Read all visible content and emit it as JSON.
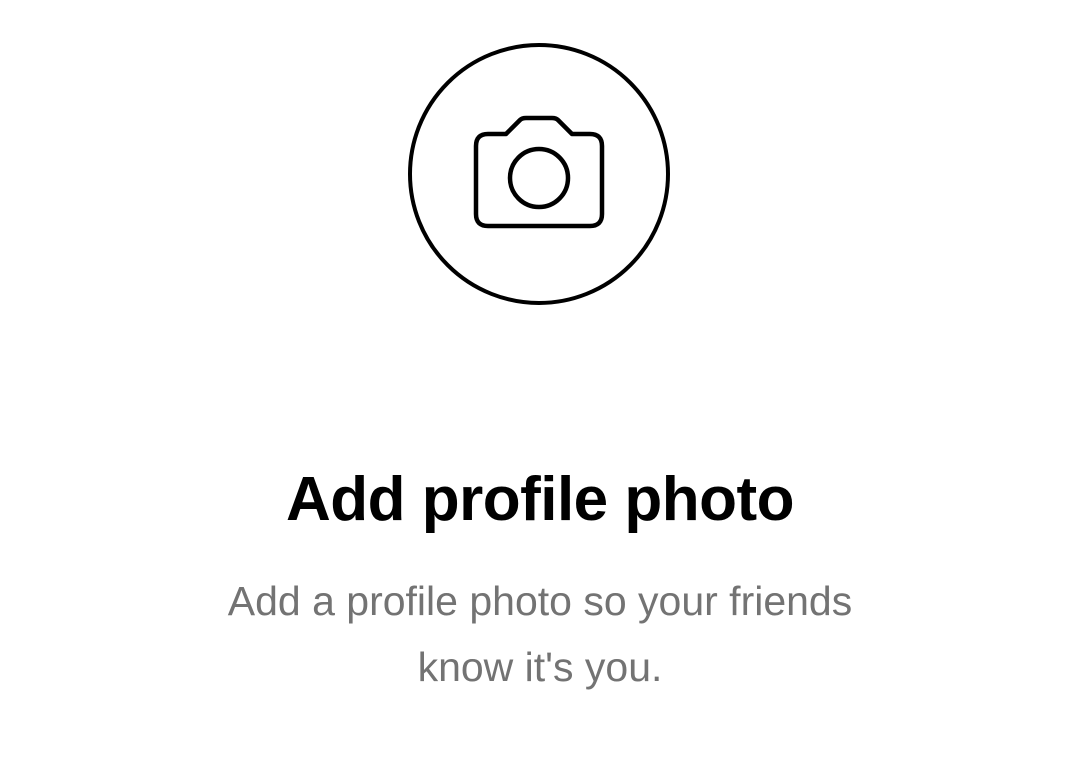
{
  "profile_photo": {
    "icon": "camera-icon",
    "title": "Add profile photo",
    "description_line1": "Add a profile photo so your friends",
    "description_line2": "know it's you."
  },
  "colors": {
    "background": "#ffffff",
    "foreground": "#000000",
    "secondary_text": "#737373"
  }
}
